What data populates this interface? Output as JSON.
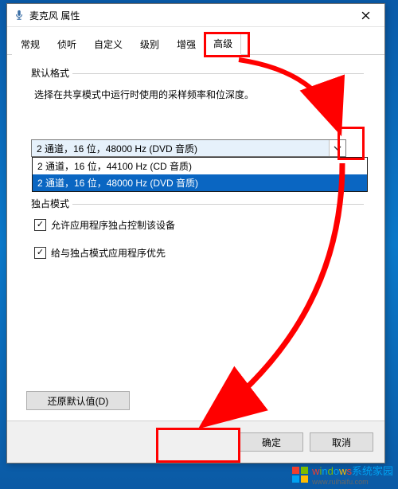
{
  "window": {
    "title": "麦克风 属性"
  },
  "tabs": {
    "t0": "常规",
    "t1": "侦听",
    "t2": "自定义",
    "t3": "级别",
    "t4": "增强",
    "t5": "高级"
  },
  "group_format": {
    "title": "默认格式",
    "desc": "选择在共享模式中运行时使用的采样频率和位深度。"
  },
  "combo": {
    "selected": "2 通道，16 位，48000 Hz (DVD 音质)",
    "options": {
      "o0": "2 通道，16 位，44100 Hz (CD 音质)",
      "o1": "2 通道，16 位，48000 Hz (DVD 音质)"
    }
  },
  "group_exclusive": {
    "title": "独占模式",
    "chk1_label": "允许应用程序独占控制该设备",
    "chk2_label": "给与独占模式应用程序优先"
  },
  "buttons": {
    "restore": "还原默认值(D)",
    "ok": "确定",
    "cancel": "取消"
  },
  "checks": {
    "c1": "✓",
    "c2": "✓"
  },
  "watermark": {
    "line1_plain": "windows系统家园",
    "line2": "www.ruihaifu.com"
  }
}
